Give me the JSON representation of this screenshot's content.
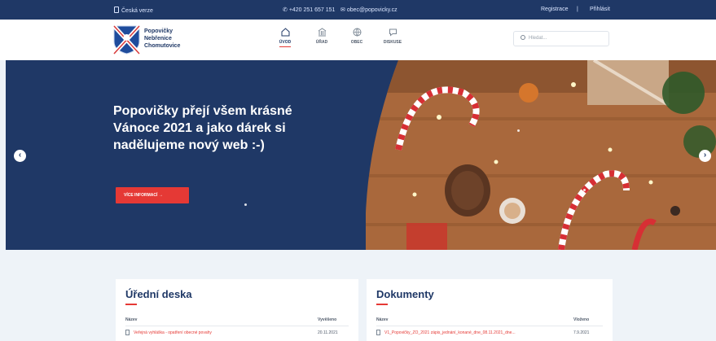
{
  "topbar": {
    "left_link": "Česká verze",
    "phone": "+420 251 657 151",
    "email": "obec@popovicky.cz",
    "register": "Registrace",
    "separator": "|",
    "login": "Přihlásit"
  },
  "header": {
    "logo_lines": [
      "Popovičky",
      "Nebřenice",
      "Chomutovice"
    ],
    "nav": [
      {
        "label": "ÚVOD",
        "icon": "home-icon",
        "active": true
      },
      {
        "label": "ÚŘAD",
        "icon": "building-icon",
        "active": false
      },
      {
        "label": "OBEC",
        "icon": "globe-icon",
        "active": false
      },
      {
        "label": "DISKUSE",
        "icon": "chat-icon",
        "active": false
      }
    ],
    "search_placeholder": "Hledat..."
  },
  "hero": {
    "title": "Popovičky přejí všem krásné Vánoce 2021 a jako dárek si nadělujeme nový web :-)",
    "button": "VÍCE INFORMACÍ →",
    "prev": "‹",
    "next": "›"
  },
  "cards": [
    {
      "title": "Úřední deska",
      "col_name": "Název",
      "col_date": "Vyvěšeno",
      "row_text": "Veřejná vyhláška - opatření obecné povahy",
      "row_date": "20.11.2021"
    },
    {
      "title": "Dokumenty",
      "col_name": "Název",
      "col_date": "Vloženo",
      "row_text": "V1_Popovičky_ZO_2021 zápis_jednání_konané_dne_08.11.2021_dne...",
      "row_date": "7.9.2021"
    }
  ],
  "colors": {
    "navy": "#1f3866",
    "accent": "#e53935",
    "background": "#eef3f8"
  }
}
